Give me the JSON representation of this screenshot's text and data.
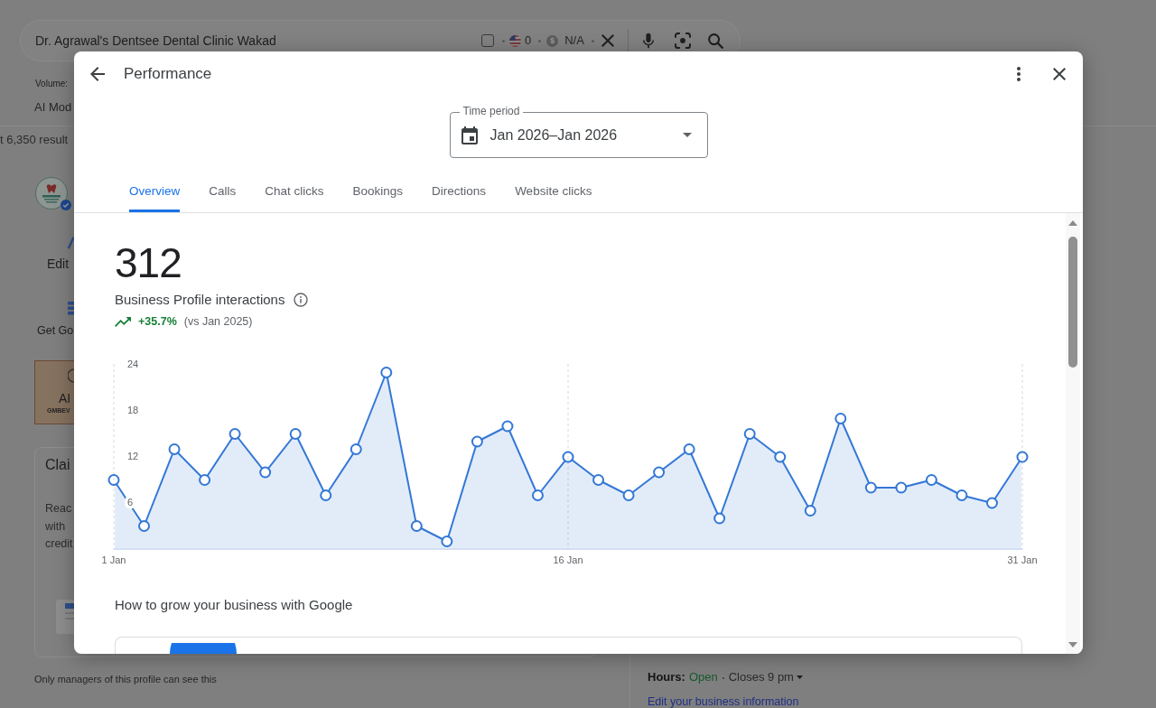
{
  "background_page": {
    "search_bar": {
      "query": "Dr. Agrawal's Dentsee Dental Clinic Wakad",
      "checked": false,
      "count": "0",
      "currency_symbol": "$",
      "price": "N/A"
    },
    "volume_label": "Volume:",
    "nav_tab": "AI Mod",
    "results_count": "t 6,350 result",
    "actions": [
      {
        "kind": "edit",
        "label": "Edit"
      },
      {
        "kind": "grid",
        "label": "Get Go"
      }
    ],
    "promo": {
      "title": "AI",
      "code": "GMBEV"
    },
    "claim_card": {
      "title": "Clai",
      "lines": [
        "Reac",
        "with",
        "credit"
      ]
    },
    "note": "Only managers of this profile can see this",
    "hours": {
      "label": "Hours:",
      "status": "Open",
      "detail": "Closes 9 pm"
    },
    "edit_link": "Edit your business information"
  },
  "dialog": {
    "title": "Performance",
    "time_period": {
      "label": "Time period",
      "value": "Jan 2026–Jan 2026"
    },
    "tabs": [
      {
        "label": "Overview",
        "selected": true
      },
      {
        "label": "Calls",
        "selected": false
      },
      {
        "label": "Chat clicks",
        "selected": false
      },
      {
        "label": "Bookings",
        "selected": false
      },
      {
        "label": "Directions",
        "selected": false
      },
      {
        "label": "Website clicks",
        "selected": false
      }
    ],
    "total": "312",
    "metric_label": "Business Profile interactions",
    "change": {
      "positive": true,
      "value": "+35.7%",
      "comparison": "(vs Jan 2025)"
    },
    "chart_data": {
      "type": "area",
      "categories": [
        "1 Jan",
        null,
        null,
        null,
        null,
        null,
        null,
        null,
        null,
        null,
        null,
        null,
        null,
        null,
        null,
        "16 Jan",
        null,
        null,
        null,
        null,
        null,
        null,
        null,
        null,
        null,
        null,
        null,
        null,
        null,
        null,
        "31 Jan"
      ],
      "series": [
        {
          "color": "#3478d6",
          "values": [
            9,
            3,
            13,
            9,
            15,
            10,
            15,
            7,
            13,
            23,
            3,
            1,
            14,
            16,
            7,
            12,
            9,
            7,
            10,
            13,
            4,
            15,
            12,
            5,
            17,
            8,
            8,
            9,
            7,
            6,
            12
          ]
        }
      ],
      "ylim": [
        0,
        24
      ],
      "yticks": [
        6,
        12,
        18,
        24
      ]
    },
    "section_title": "How to grow your business with Google"
  }
}
